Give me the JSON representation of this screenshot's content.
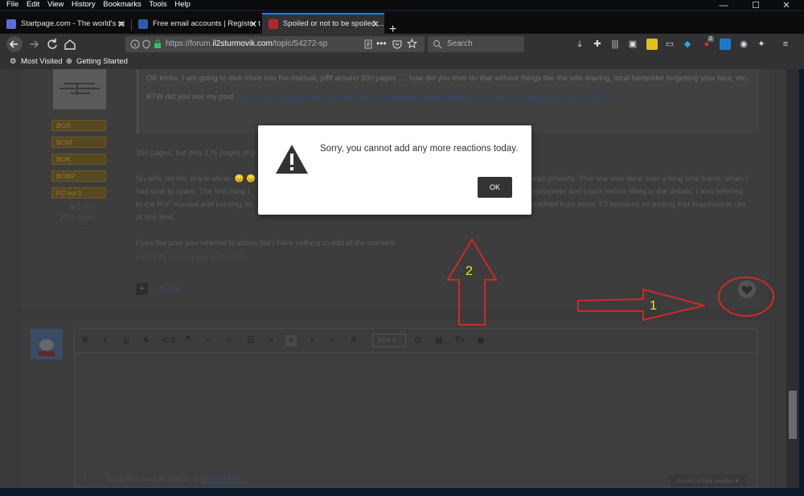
{
  "menubar": {
    "items": [
      "File",
      "Edit",
      "View",
      "History",
      "Bookmarks",
      "Tools",
      "Help"
    ]
  },
  "window_controls": {
    "minimize": "—",
    "maximize": "☐",
    "close": "✕"
  },
  "tabs": [
    {
      "label": "Startpage.com - The world's m",
      "favicon_color": "#5a6fd6",
      "active": false
    },
    {
      "label": "Free email accounts | Register t",
      "favicon_color": "#2a5db0",
      "active": false
    },
    {
      "label": "Spoiled or not to be spoiled ...",
      "favicon_color": "#b12a2a",
      "active": true
    }
  ],
  "new_tab_label": "+",
  "tab_close": "✕",
  "nav": {
    "url_prefix": "https://forum.",
    "url_domain": "il2sturmovik.com",
    "url_rest": "/topic/54272-sp",
    "search_placeholder": "Search",
    "toolbar_badge": "2"
  },
  "bookmarks": [
    "Most Visited",
    "Getting Started"
  ],
  "profile": {
    "badges": [
      "BOS",
      "BOM",
      "BOK",
      "BOBP",
      "FC vol 1"
    ],
    "reputation": "270",
    "posts": "2326 posts",
    "location": "Location:Canada"
  },
  "quote": {
    "line1": "OK thnkx. I am going to dive more into the manual, pffff around 300 pages .... how did you ever do that without things like the wife leaving, local bartender forgetting your face, etc.",
    "line2_prefix": "BTW did you see my post ",
    "line2_link": "https://forum.il2sturmovik.com/topic/54271-bodenplatte-map-buildings-error/?tab=comments#comment-825475"
  },
  "post": {
    "p1": "350 pages, but only 175 pages of p",
    "p2_left": "No wife, no life, drank alone. 😞 😞",
    "p2_right": "arge projects. This one was done over a long time frame, when I",
    "p3_left": "had time to spare. The first thing I",
    "p3_right": "o chapters and topics before filling in the details. I also referred",
    "p4_left": "to the RoF manual and existing Yo",
    "p4_right": "enefited from some TS sessions on editing that Haashashin ran",
    "p5": "at one time.",
    "p6": "I saw the post you referred to above but I have nothing to add at the moment.",
    "edited": "Edited 25 minutes ago by JimTM",
    "quote_label": "Quote",
    "plus": "+"
  },
  "editor": {
    "size_label": "Size",
    "drop_text": "Drag files here to attach, or ",
    "choose_files": "choose files...",
    "insert_media": "Insert other media ▾"
  },
  "dialog": {
    "message": "Sorry, you cannot add any more reactions today.",
    "ok_label": "OK"
  },
  "annotations": {
    "label1": "1",
    "label2": "2",
    "color": "#d22828",
    "text_color": "#f2e33a"
  }
}
